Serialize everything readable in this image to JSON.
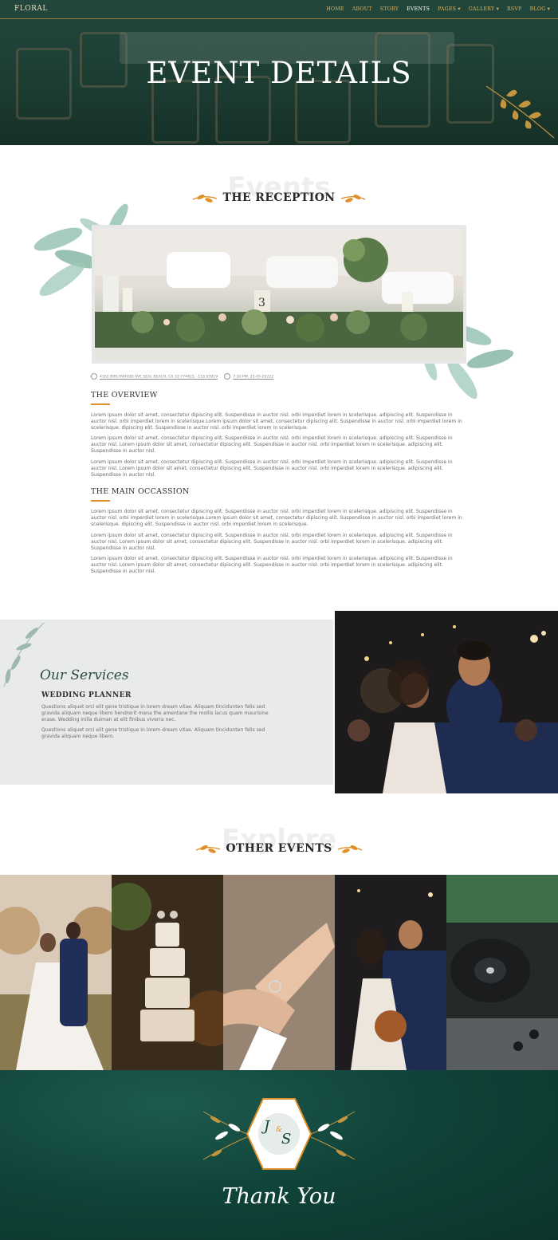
{
  "nav": {
    "logo": "FLORAL",
    "items": [
      {
        "label": "HOME"
      },
      {
        "label": "ABOUT"
      },
      {
        "label": "STORY"
      },
      {
        "label": "EVENTS"
      },
      {
        "label": "PAGES ▾"
      },
      {
        "label": "GALLERY ▾"
      },
      {
        "label": "RSVP"
      },
      {
        "label": "BLOG ▾"
      }
    ]
  },
  "hero": {
    "title": "EVENT DETAILS"
  },
  "reception": {
    "ghost": "Events",
    "title": "THE RECEPTION",
    "address": "4161 BIRCHWOOD AVE SEAL BEACH, CA 33.774825, -118.05919",
    "datetime": "7:30 PM, 25-05-20222"
  },
  "overview": {
    "title": "THE OVERVIEW",
    "p1": "Lorem ipsum dolor sit amet, consectetur dipiscing elit. Suspendisse in auctor nisl. orbi imperdiet lorem in scelerisque. adipiscing elit. Suspendisse in auctor nisl. orbi imperdiet lorem in scelerisque.Lorem ipsum dolor sit amet, consectetur dipiscing elit. Suspendisse in auctor nisl. orbi imperdiet lorem in scelerisque. dipiscing elit. Suspendisse in auctor nisl. orbi imperdiet lorem in scelerisque.",
    "p2": "Lorem ipsum dolor sit amet, consectetur dipiscing elit. Suspendisse in auctor nisl. orbi imperdiet lorem in scelerisque. adipiscing elit. Suspendisse in auctor nisl. Lorem ipsum dolor sit amet, consectetur dipiscing elit. Suspendisse in auctor nisl. orbi imperdiet lorem in scelerisque. adipiscing elit. Suspendisse in auctor nisl.",
    "p3": "Lorem ipsum dolor sit amet, consectetur dipiscing elit. Suspendisse in auctor nisl. orbi imperdiet lorem in scelerisque. adipiscing elit. Suspendisse in auctor nisl. Lorem ipsum dolor sit amet, consectetur dipiscing elit. Suspendisse in auctor nisl. orbi imperdiet lorem in scelerisque. adipiscing elit. Suspendisse in auctor nisl."
  },
  "occasion": {
    "title": "THE MAIN OCCASSION",
    "p1": "Lorem ipsum dolor sit amet, consectetur dipiscing elit. Suspendisse in auctor nisl. orbi imperdiet lorem in scelerisque. adipiscing elit. Suspendisse in auctor nisl. orbi imperdiet lorem in scelerisque.Lorem ipsum dolor sit amet, consectetur dipiscing elit. Suspendisse in auctor nisl. orbi imperdiet lorem in scelerisque. dipiscing elit. Suspendisse in auctor nisl. orbi imperdiet lorem in scelerisque.",
    "p2": "Lorem ipsum dolor sit amet, consectetur dipiscing elit. Suspendisse in auctor nisl. orbi imperdiet lorem in scelerisque. adipiscing elit. Suspendisse in auctor nisl. Lorem ipsum dolor sit amet, consectetur dipiscing elit. Suspendisse in auctor nisl. orbi imperdiet lorem in scelerisque. adipiscing elit. Suspendisse in auctor nisl.",
    "p3": "Lorem ipsum dolor sit amet, consectetur dipiscing elit. Suspendisse in auctor nisl. orbi imperdiet lorem in scelerisque. adipiscing elit. Suspendisse in auctor nisl. Lorem ipsum dolor sit amet, consectetur dipiscing elit. Suspendisse in auctor nisl. orbi imperdiet lorem in scelerisque. adipiscing elit. Suspendisse in auctor nisl."
  },
  "services": {
    "script": "Our Services",
    "title": "WEDDING PLANNER",
    "p1": "Questions aliquet orci elit gene tristique in lorem dream vitae. Aliquam tincidunten felis sed gravida aliquam neque libero hendrerit mana the amentane the mollis lacus quam maurisine erase. Wedding inilla duiman at elit finibus viverra nec.",
    "p2": "Questions aliquet orci elit gene tristique in lorem dream vitae. Aliquam tincidunten felis sed gravida aliquam neque libero."
  },
  "other": {
    "ghost": "Explore",
    "title": "OTHER EVENTS"
  },
  "footer": {
    "monogram_left": "J",
    "monogram_amp": "&",
    "monogram_right": "S",
    "thanks": "Thank You"
  },
  "colors": {
    "accent": "#e0902a",
    "dark_green": "#1d3d33",
    "footer_green": "#0f4238",
    "gold": "#d9b25f"
  }
}
